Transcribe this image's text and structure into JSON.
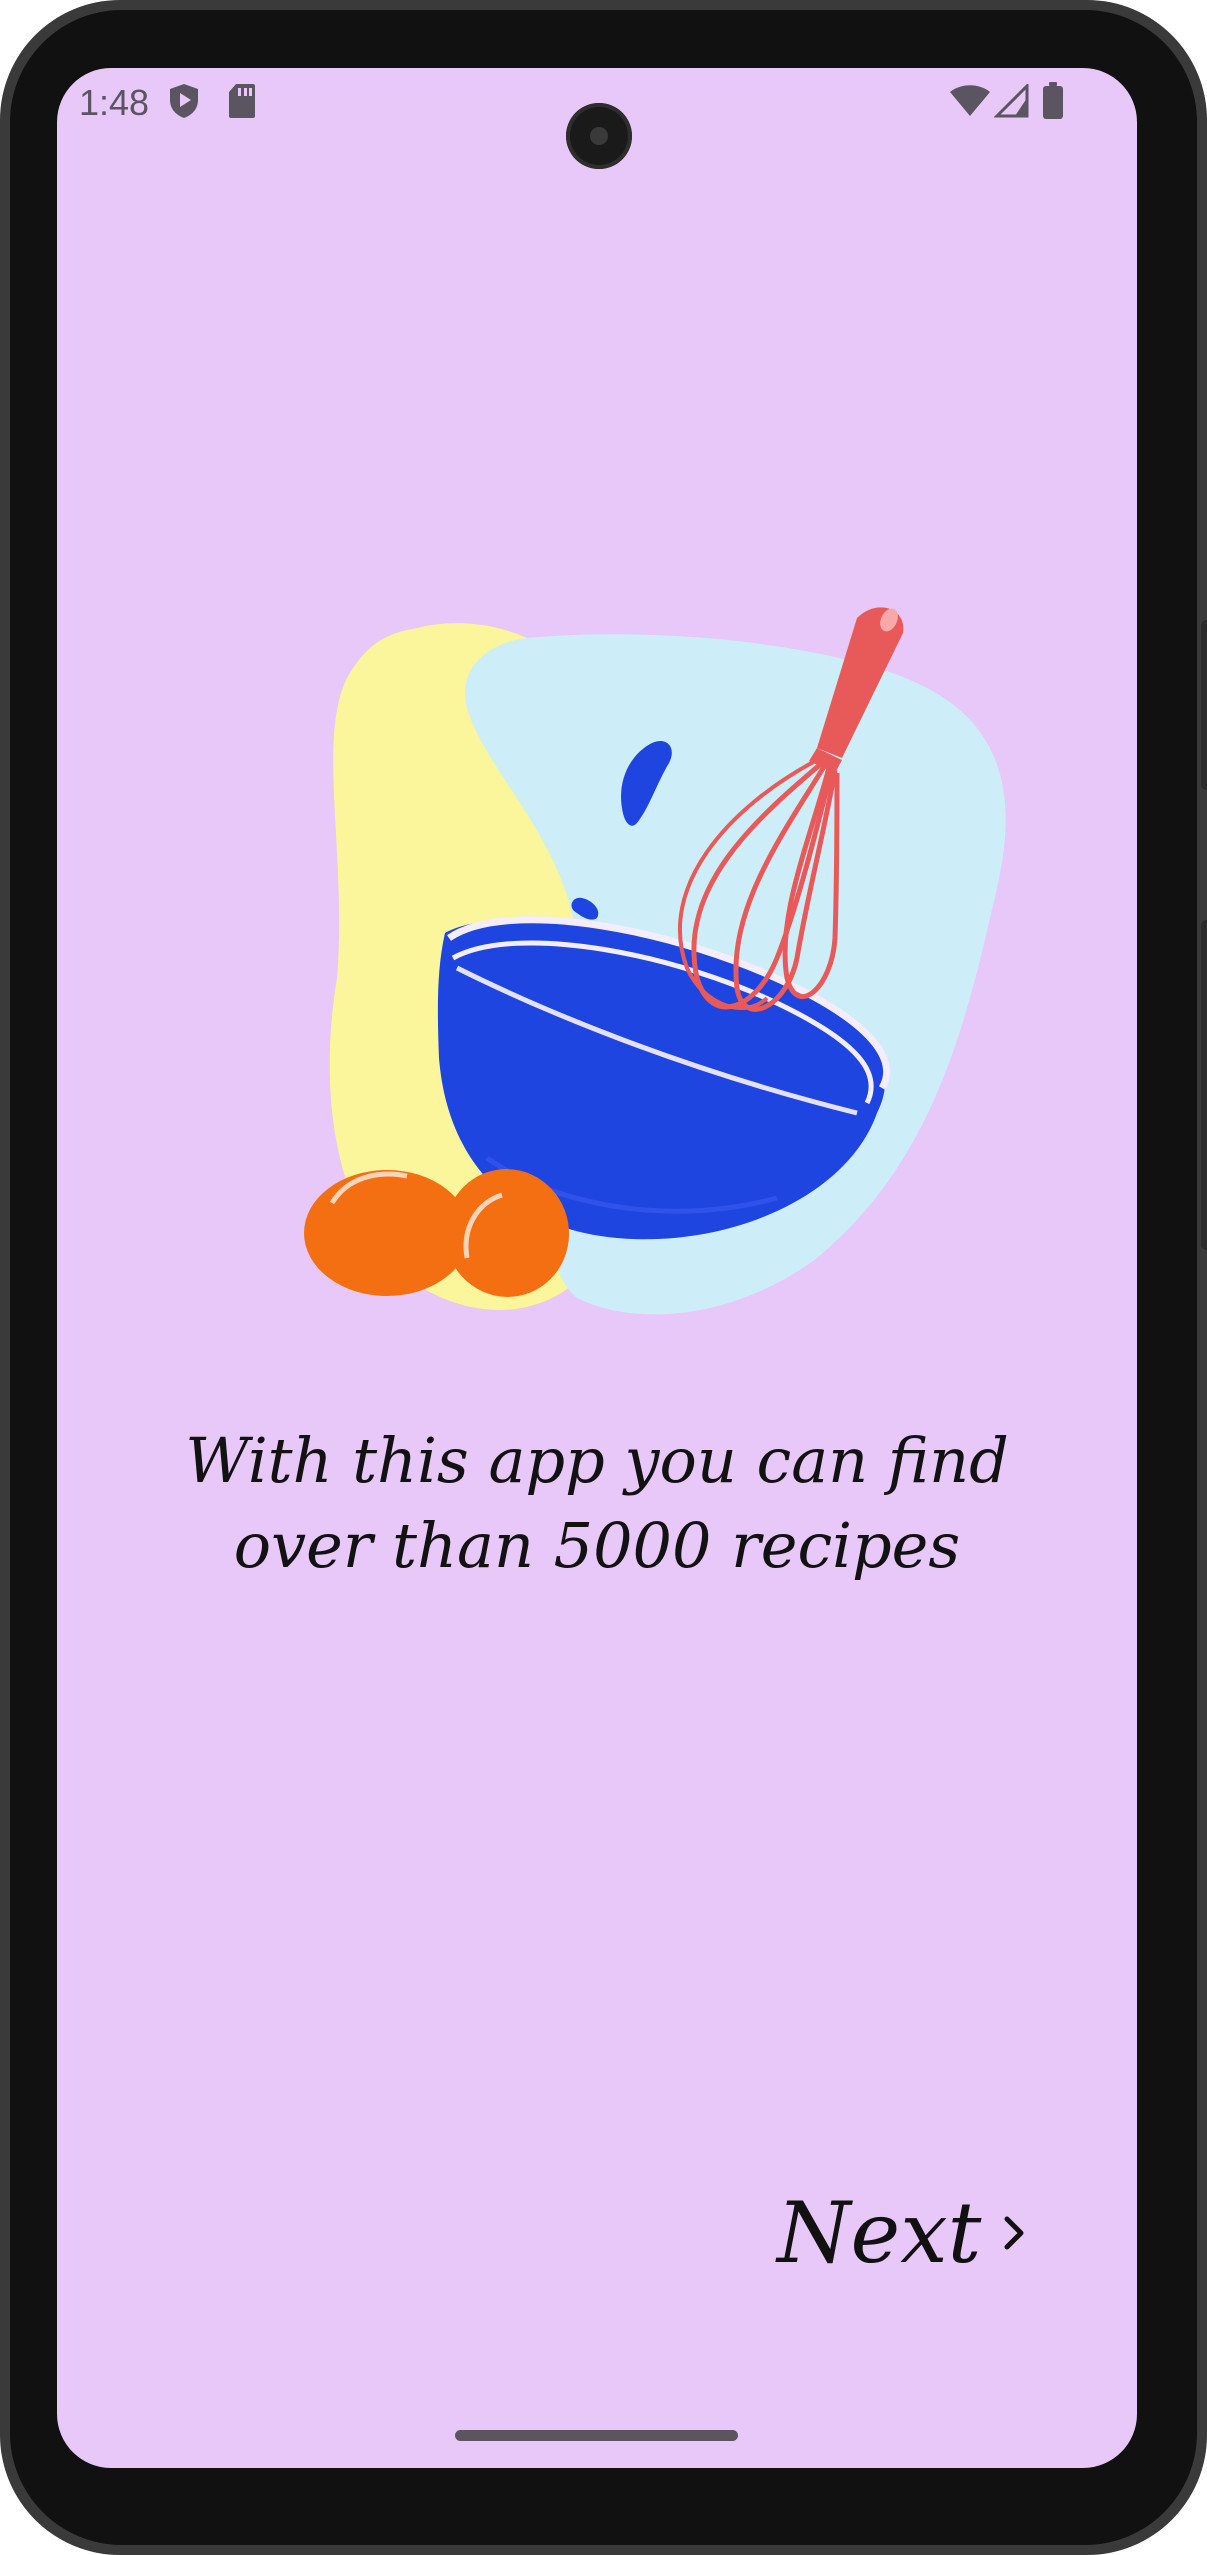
{
  "status_bar": {
    "time": "1:48",
    "left_icons": [
      "shield-play-icon",
      "sd-card-icon"
    ],
    "right_icons": [
      "wifi-icon",
      "signal-icon",
      "battery-icon"
    ]
  },
  "onboarding": {
    "message": "With this app you can find over than 5000 recipes",
    "next_label": "Next",
    "illustration": "mixing-bowl-whisk-eggs-illustration"
  },
  "colors": {
    "screen_background": "#e7c8f8",
    "bowl": "#1f45e0",
    "whisk": "#e85a5a",
    "egg": "#f46f12",
    "blob_yellow": "#fbf59c",
    "blob_blue": "#cdeef8"
  }
}
